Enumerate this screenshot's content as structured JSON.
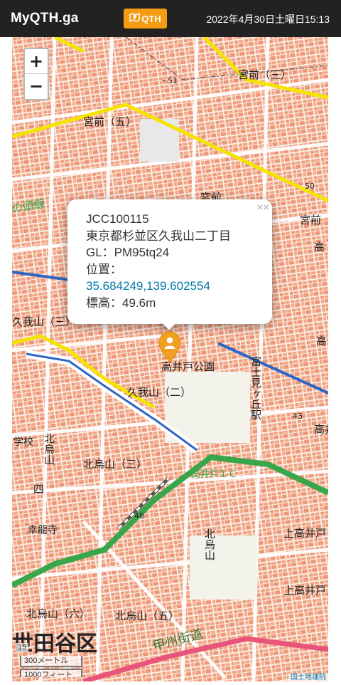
{
  "navbar": {
    "brand": "MyQTH.ga",
    "qth_button_label": "QTH",
    "qth_icon": "map-pin-icon",
    "datetime": "2022年4月30日土曜日15:13",
    "bg_color": "#222222",
    "button_color": "#f39c12"
  },
  "map": {
    "zoom_in_label": "+",
    "zoom_out_label": "−",
    "labels": {
      "miyamae_san_top": "宮前（三）",
      "miyamae_go": "宮前（五）",
      "miyamae_mid": "宮前",
      "miyamae_right": "宮前",
      "kugayama_san": "久我山（三）",
      "kugayama_ni": "久我山（二）",
      "takaido_koen": "高井戸公園",
      "fujimigaoka_station": "富士見ヶ丘駅",
      "takaido_ic": "高井戸ＩＣ",
      "kitakarasuyama_san": "北烏山（三）",
      "kitakarasuyama_left": "北烏山",
      "kitakarasuyama_right": "北烏山",
      "kitakarasuyama_roku": "北烏山（六）",
      "kitakarasuyama_go": "北烏山（五）",
      "setagaya_ku": "世田谷区",
      "koshu_kaido": "甲州街道",
      "kami_takaido": "上高井戸",
      "kami_takaido_2": "上高井戸",
      "takaido": "高井",
      "rail_line": "の頭線",
      "school": "学校",
      "koryuji": "幸龍寺",
      "road_50": "50",
      "road_43": "43",
      "road_48": "48",
      "spot_51": "51",
      "dashed_top": "・51",
      "kugayama_short": "四",
      "ku_right": "高井",
      "right_kou": "高",
      "right_kou2": "高",
      "right_kou3": "高",
      "right_kou4": "高井"
    },
    "popup": {
      "code": "JCC100115",
      "address": "東京都杉並区久我山二丁目",
      "gl": "GL：PM95tq24",
      "position_label": "位置：",
      "coordinates": "35.684249,139.602554",
      "elevation": "標高：49.6m",
      "close_label": "××"
    },
    "marker_icon": "person-marker-icon",
    "zoom_level": "15",
    "scale_metric": "300メートル",
    "scale_imperial": "1000フィート",
    "attribution": "国土地理院"
  }
}
